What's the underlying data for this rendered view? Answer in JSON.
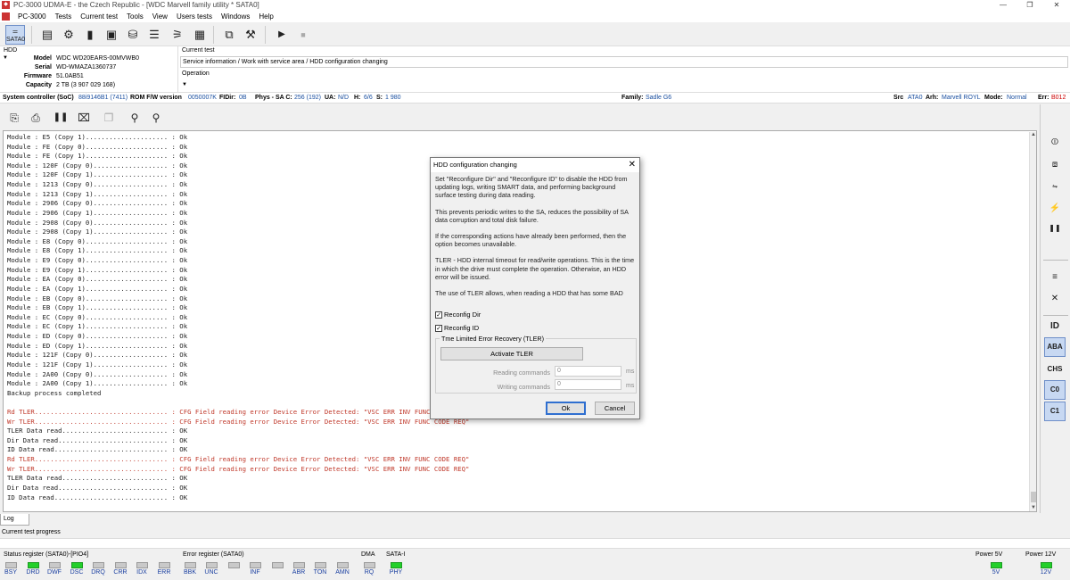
{
  "window": {
    "title": "PC-3000 UDMA-E - the Czech Republic - [WDC Marvell family utility * SATA0]",
    "app_short": "PC-3000",
    "controls": [
      "—",
      "❐",
      "✕"
    ]
  },
  "menu": [
    "PC-3000",
    "Tests",
    "Current test",
    "Tools",
    "View",
    "Users tests",
    "Windows",
    "Help"
  ],
  "toolbar1": {
    "sata_label": "SATA0"
  },
  "hdd": {
    "label": "HDD",
    "fields": [
      {
        "key": "Model",
        "value": "WDC WD20EARS-00MVWB0"
      },
      {
        "key": "Serial",
        "value": "WD-WMAZA1360737"
      },
      {
        "key": "Firmware",
        "value": "51.0AB51"
      },
      {
        "key": "Capacity",
        "value": "2 TB (3 907 029 168)"
      }
    ]
  },
  "current_test": {
    "label": "Current test",
    "value": "Service information / Work with service area / HDD configuration changing",
    "operation_label": "Operation"
  },
  "system_bar": {
    "soc_label": "System controller (SoC)",
    "soc_value": "88i9146B1 (7411)",
    "rom_label": "ROM F/W version",
    "rom_value": "0050007K",
    "fidir_label": "FIDir:",
    "fidir_value": "0B",
    "phys_label": "Phys - SA C:",
    "phys_value": "256 (192)",
    "ua_label": "UA:",
    "ua_value": "N/D",
    "h_label": "H:",
    "h_value": "6/6",
    "s_label": "S:",
    "s_value": "1 980",
    "family_label": "Family:",
    "family_value": "Sadle G6",
    "src_label": "Src",
    "src_value": "ATA0",
    "arh_label": "Arh:",
    "arh_value": "Marvell ROYL",
    "mode_label": "Mode:",
    "mode_value": "Normal",
    "err_label": "Err:",
    "err_value": "B012"
  },
  "log": {
    "lines": [
      {
        "t": "Module : E5 (Copy 1)..................... : Ok",
        "err": false
      },
      {
        "t": "Module : FE (Copy 0)..................... : Ok",
        "err": false
      },
      {
        "t": "Module : FE (Copy 1)..................... : Ok",
        "err": false
      },
      {
        "t": "Module : 120F (Copy 0)................... : Ok",
        "err": false
      },
      {
        "t": "Module : 120F (Copy 1)................... : Ok",
        "err": false
      },
      {
        "t": "Module : 1213 (Copy 0)................... : Ok",
        "err": false
      },
      {
        "t": "Module : 1213 (Copy 1)................... : Ok",
        "err": false
      },
      {
        "t": "Module : 2906 (Copy 0)................... : Ok",
        "err": false
      },
      {
        "t": "Module : 2906 (Copy 1)................... : Ok",
        "err": false
      },
      {
        "t": "Module : 2908 (Copy 0)................... : Ok",
        "err": false
      },
      {
        "t": "Module : 2908 (Copy 1)................... : Ok",
        "err": false
      },
      {
        "t": "Module : E8 (Copy 0)..................... : Ok",
        "err": false
      },
      {
        "t": "Module : E8 (Copy 1)..................... : Ok",
        "err": false
      },
      {
        "t": "Module : E9 (Copy 0)..................... : Ok",
        "err": false
      },
      {
        "t": "Module : E9 (Copy 1)..................... : Ok",
        "err": false
      },
      {
        "t": "Module : EA (Copy 0)..................... : Ok",
        "err": false
      },
      {
        "t": "Module : EA (Copy 1)..................... : Ok",
        "err": false
      },
      {
        "t": "Module : EB (Copy 0)..................... : Ok",
        "err": false
      },
      {
        "t": "Module : EB (Copy 1)..................... : Ok",
        "err": false
      },
      {
        "t": "Module : EC (Copy 0)..................... : Ok",
        "err": false
      },
      {
        "t": "Module : EC (Copy 1)..................... : Ok",
        "err": false
      },
      {
        "t": "Module : ED (Copy 0)..................... : Ok",
        "err": false
      },
      {
        "t": "Module : ED (Copy 1)..................... : Ok",
        "err": false
      },
      {
        "t": "Module : 121F (Copy 0)................... : Ok",
        "err": false
      },
      {
        "t": "Module : 121F (Copy 1)................... : Ok",
        "err": false
      },
      {
        "t": "Module : 2A00 (Copy 0)................... : Ok",
        "err": false
      },
      {
        "t": "Module : 2A00 (Copy 1)................... : Ok",
        "err": false
      },
      {
        "t": "Backup process completed",
        "err": false
      },
      {
        "t": "",
        "err": false
      },
      {
        "t": "Rd TLER.................................. : CFG Field reading error Device Error Detected: \"VSC ERR INV FUNC CODE REQ\"",
        "err": true
      },
      {
        "t": "Wr TLER.................................. : CFG Field reading error Device Error Detected: \"VSC ERR INV FUNC CODE REQ\"",
        "err": true
      },
      {
        "t": "TLER Data read........................... : OK",
        "err": false
      },
      {
        "t": "Dir Data read............................ : OK",
        "err": false
      },
      {
        "t": "ID Data read............................. : OK",
        "err": false
      },
      {
        "t": "Rd TLER.................................. : CFG Field reading error Device Error Detected: \"VSC ERR INV FUNC CODE REQ\"",
        "err": true
      },
      {
        "t": "Wr TLER.................................. : CFG Field reading error Device Error Detected: \"VSC ERR INV FUNC CODE REQ\"",
        "err": true
      },
      {
        "t": "TLER Data read........................... : OK",
        "err": false
      },
      {
        "t": "Dir Data read............................ : OK",
        "err": false
      },
      {
        "t": "ID Data read............................. : OK",
        "err": false
      }
    ]
  },
  "log_tab": "Log",
  "progress_label": "Current test progress",
  "right_panel": {
    "buttons": [
      "ID",
      "ABA",
      "CHS",
      "C0",
      "C1"
    ]
  },
  "dialog": {
    "title": "HDD configuration changing",
    "paragraphs": [
      "Set \"Reconfigure Dir\" and \"Reconfigure ID\" to disable the HDD from updating logs, writing SMART data, and performing background surface testing during data reading.",
      "This prevents periodic writes to the SA, reduces the possibility of SA data corruption and total disk failure.",
      "If the corresponding actions have already been performed, then the option becomes unavailable.",
      "TLER - HDD internal timeout for read/write operations. This is the time in which the drive must complete the operation. Otherwise, an HDD error will be issued.",
      "The use of TLER allows, when reading a HDD that has some BAD"
    ],
    "checkboxes": [
      {
        "label": "Reconfig Dir",
        "checked": true
      },
      {
        "label": "Reconfig ID",
        "checked": true
      }
    ],
    "tler_group": "Tme Limited Error Recovery (TLER)",
    "activate_label": "Activate TLER",
    "reading_label": "Reading commands",
    "reading_value": "0",
    "writing_label": "Writing commands",
    "writing_value": "0",
    "unit": "ms",
    "ok_label": "Ok",
    "cancel_label": "Cancel"
  },
  "status": {
    "status_register_label": "Status register (SATA0)-[PIO4]",
    "status_leds": [
      {
        "name": "BSY",
        "on": false
      },
      {
        "name": "DRD",
        "on": true
      },
      {
        "name": "DWF",
        "on": false
      },
      {
        "name": "DSC",
        "on": true
      },
      {
        "name": "DRQ",
        "on": false
      },
      {
        "name": "CRR",
        "on": false
      },
      {
        "name": "IDX",
        "on": false
      },
      {
        "name": "ERR",
        "on": false
      }
    ],
    "error_register_label": "Error register (SATA0)",
    "error_leds": [
      {
        "name": "BBK",
        "on": false
      },
      {
        "name": "UNC",
        "on": false
      },
      {
        "name": "",
        "on": false
      },
      {
        "name": "INF",
        "on": false
      },
      {
        "name": "",
        "on": false
      },
      {
        "name": "ABR",
        "on": false
      },
      {
        "name": "TON",
        "on": false
      },
      {
        "name": "AMN",
        "on": false
      }
    ],
    "dma_label": "DMA",
    "dma_led": {
      "name": "RQ",
      "on": false
    },
    "sata_label": "SATA-I",
    "sata_led": {
      "name": "PHY",
      "on": true
    },
    "power5_label": "Power 5V",
    "power5_led": {
      "name": "5V",
      "on": true
    },
    "power12_label": "Power 12V",
    "power12_led": {
      "name": "12V",
      "on": true
    }
  },
  "colors": {
    "led_on": "#22d02a",
    "led_off": "#c9c9c9",
    "error_text": "#c0392b",
    "accent_blue": "#1a4fa0"
  }
}
